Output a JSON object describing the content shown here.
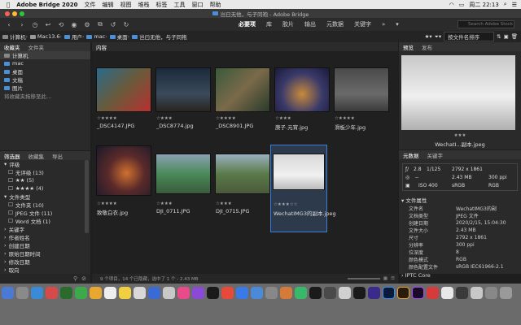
{
  "menubar": {
    "apple": "",
    "app": "Adobe Bridge 2020",
    "items": [
      "文件",
      "编辑",
      "视图",
      "堆栈",
      "标签",
      "工具",
      "窗口",
      "帮助"
    ],
    "clock": "周二 22:13"
  },
  "title": "岂曰无他，与子同袍 - Adobe Bridge",
  "toolbar": {
    "workspaces": [
      "必要项",
      "库",
      "胶片",
      "输出",
      "元数据",
      "关键字"
    ],
    "active": "必要项",
    "search_placeholder": "Search Adobe Stock"
  },
  "path": [
    "计算机",
    "Mac13.6",
    "用户",
    "mac",
    "桌面",
    "岂曰无他，与子同袍"
  ],
  "sort": "按文件名排序",
  "favorites": {
    "tabs": [
      "收藏夹",
      "文件夹"
    ],
    "items": [
      "计算机",
      "mac",
      "桌面",
      "文稿",
      "图片"
    ],
    "hint": "将收藏夹拖移至此..."
  },
  "filter": {
    "tabs": [
      "筛选器",
      "收藏集",
      "导出"
    ],
    "groups": [
      {
        "label": "评级",
        "items": [
          "无评级 (13)",
          "★★ (5)",
          "★★★★ (4)"
        ]
      },
      {
        "label": "文件类型",
        "items": [
          "文件夹 (10)",
          "JPEG 文件 (11)",
          "Word 文档 (1)"
        ]
      },
      {
        "label": "关键字"
      },
      {
        "label": "作者姓名"
      },
      {
        "label": "创建日期"
      },
      {
        "label": "原始日期时间"
      },
      {
        "label": "修改日期"
      },
      {
        "label": "取向"
      }
    ]
  },
  "content": {
    "title": "内容",
    "items": [
      {
        "name": "_DSC4147.JPG",
        "stars": "☆★★★★"
      },
      {
        "name": "_DSC8774.jpg",
        "stars": "☆★★★"
      },
      {
        "name": "_DSC8901.JPG",
        "stars": "☆★★★★"
      },
      {
        "name": "庚子.元宵.jpg",
        "stars": "☆★★★"
      },
      {
        "name": "滑板少年.jpg",
        "stars": "☆★★★★"
      },
      {
        "name": "致敬白衣.jpg",
        "stars": "☆★★★★"
      },
      {
        "name": "DJI_0711.JPG",
        "stars": "☆★★★"
      },
      {
        "name": "DJI_0715.JPG",
        "stars": "☆★★★"
      },
      {
        "name": "WechatIMG3的副本.jpeg",
        "stars": "☆★★★☆☆"
      }
    ]
  },
  "status": "9 个项目，14 个已隐藏，选中了 1 个 - 2.43 MB",
  "preview": {
    "tabs": [
      "预览",
      "发布"
    ],
    "stars": "★★★",
    "caption": "WechatI...副本.jpeg"
  },
  "metadata": {
    "tabs": [
      "元数据",
      "关键字"
    ],
    "quick": {
      "fstop": "2.8",
      "shutter": "1/125",
      "dim": "2792 x 1861",
      "size": "2.43 MB",
      "ppi": "300 ppi",
      "iso": "ISO 400",
      "srgb": "sRGB",
      "rgb": "RGB",
      "dash": "--"
    },
    "section": "文件属性",
    "rows": [
      {
        "k": "文件名",
        "v": "WechatIMG3的副"
      },
      {
        "k": "文档类型",
        "v": "JPEG 文件"
      },
      {
        "k": "创建日期",
        "v": "2020/2/15, 15:04:30"
      },
      {
        "k": "文件大小",
        "v": "2.43 MB"
      },
      {
        "k": "尺寸",
        "v": "2792 x 1861"
      },
      {
        "k": "分辨率",
        "v": "300 ppi"
      },
      {
        "k": "位深度",
        "v": "8"
      },
      {
        "k": "颜色模式",
        "v": "RGB"
      },
      {
        "k": "颜色配置文件",
        "v": "sRGB IEC61966-2.1"
      }
    ],
    "iptc": "IPTC Core"
  }
}
